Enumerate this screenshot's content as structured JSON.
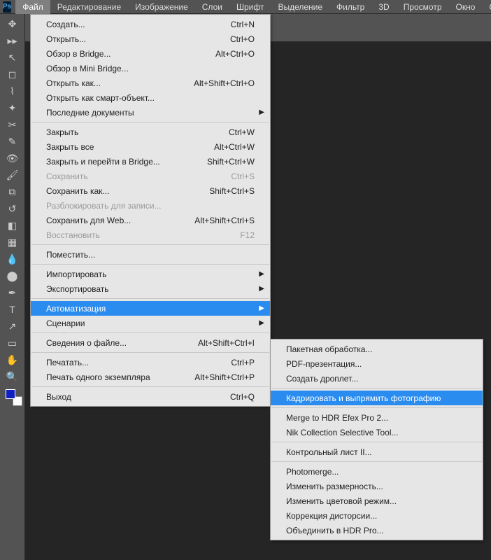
{
  "menubar": {
    "items": [
      "Файл",
      "Редактирование",
      "Изображение",
      "Слои",
      "Шрифт",
      "Выделение",
      "Фильтр",
      "3D",
      "Просмотр",
      "Окно",
      "Справка"
    ],
    "active_index": 0
  },
  "file_menu": [
    {
      "type": "item",
      "label": "Создать...",
      "shortcut": "Ctrl+N"
    },
    {
      "type": "item",
      "label": "Открыть...",
      "shortcut": "Ctrl+O"
    },
    {
      "type": "item",
      "label": "Обзор в Bridge...",
      "shortcut": "Alt+Ctrl+O"
    },
    {
      "type": "item",
      "label": "Обзор в Mini Bridge..."
    },
    {
      "type": "item",
      "label": "Открыть как...",
      "shortcut": "Alt+Shift+Ctrl+O"
    },
    {
      "type": "item",
      "label": "Открыть как смарт-объект..."
    },
    {
      "type": "item",
      "label": "Последние документы",
      "submenu": true
    },
    {
      "type": "sep"
    },
    {
      "type": "item",
      "label": "Закрыть",
      "shortcut": "Ctrl+W"
    },
    {
      "type": "item",
      "label": "Закрыть все",
      "shortcut": "Alt+Ctrl+W"
    },
    {
      "type": "item",
      "label": "Закрыть и перейти в Bridge...",
      "shortcut": "Shift+Ctrl+W"
    },
    {
      "type": "item",
      "label": "Сохранить",
      "shortcut": "Ctrl+S",
      "disabled": true
    },
    {
      "type": "item",
      "label": "Сохранить как...",
      "shortcut": "Shift+Ctrl+S"
    },
    {
      "type": "item",
      "label": "Разблокировать для записи...",
      "disabled": true
    },
    {
      "type": "item",
      "label": "Сохранить для Web...",
      "shortcut": "Alt+Shift+Ctrl+S"
    },
    {
      "type": "item",
      "label": "Восстановить",
      "shortcut": "F12",
      "disabled": true
    },
    {
      "type": "sep"
    },
    {
      "type": "item",
      "label": "Поместить..."
    },
    {
      "type": "sep"
    },
    {
      "type": "item",
      "label": "Импортировать",
      "submenu": true
    },
    {
      "type": "item",
      "label": "Экспортировать",
      "submenu": true
    },
    {
      "type": "sep"
    },
    {
      "type": "item",
      "label": "Автоматизация",
      "submenu": true,
      "highlighted": true
    },
    {
      "type": "item",
      "label": "Сценарии",
      "submenu": true
    },
    {
      "type": "sep"
    },
    {
      "type": "item",
      "label": "Сведения о файле...",
      "shortcut": "Alt+Shift+Ctrl+I"
    },
    {
      "type": "sep"
    },
    {
      "type": "item",
      "label": "Печатать...",
      "shortcut": "Ctrl+P"
    },
    {
      "type": "item",
      "label": "Печать одного экземпляра",
      "shortcut": "Alt+Shift+Ctrl+P"
    },
    {
      "type": "sep"
    },
    {
      "type": "item",
      "label": "Выход",
      "shortcut": "Ctrl+Q"
    }
  ],
  "automation_submenu": [
    {
      "type": "item",
      "label": "Пакетная обработка..."
    },
    {
      "type": "item",
      "label": "PDF-презентация..."
    },
    {
      "type": "item",
      "label": "Создать дроплет..."
    },
    {
      "type": "sep"
    },
    {
      "type": "item",
      "label": "Кадрировать и выпрямить фотографию",
      "highlighted": true
    },
    {
      "type": "sep"
    },
    {
      "type": "item",
      "label": "Merge to HDR Efex Pro 2..."
    },
    {
      "type": "item",
      "label": "Nik Collection Selective Tool..."
    },
    {
      "type": "sep"
    },
    {
      "type": "item",
      "label": "Контрольный лист II..."
    },
    {
      "type": "sep"
    },
    {
      "type": "item",
      "label": "Photomerge..."
    },
    {
      "type": "item",
      "label": "Изменить размерность..."
    },
    {
      "type": "item",
      "label": "Изменить цветовой режим..."
    },
    {
      "type": "item",
      "label": "Коррекция дисторсии..."
    },
    {
      "type": "item",
      "label": "Объединить в HDR Pro..."
    }
  ],
  "tools": [
    {
      "name": "move-tool",
      "glyph": "✥"
    },
    {
      "name": "expand-tool",
      "glyph": "▸▸"
    },
    {
      "name": "sep"
    },
    {
      "name": "arrow-tool",
      "glyph": "↖"
    },
    {
      "name": "marquee-tool",
      "glyph": "◻"
    },
    {
      "name": "lasso-tool",
      "glyph": "⌇"
    },
    {
      "name": "wand-tool",
      "glyph": "✦"
    },
    {
      "name": "crop-tool",
      "glyph": "✂"
    },
    {
      "name": "eyedropper-tool",
      "glyph": "✎"
    },
    {
      "name": "eye-tool",
      "glyph": "👁"
    },
    {
      "name": "brush-tool",
      "glyph": "🖌"
    },
    {
      "name": "stamp-tool",
      "glyph": "⧉"
    },
    {
      "name": "history-tool",
      "glyph": "↺"
    },
    {
      "name": "eraser-tool",
      "glyph": "◧"
    },
    {
      "name": "gradient-tool",
      "glyph": "▦"
    },
    {
      "name": "blur-tool",
      "glyph": "💧"
    },
    {
      "name": "dodge-tool",
      "glyph": "⬤"
    },
    {
      "name": "pen-tool",
      "glyph": "✒"
    },
    {
      "name": "type-tool",
      "glyph": "T"
    },
    {
      "name": "path-tool",
      "glyph": "↗"
    },
    {
      "name": "shape-tool",
      "glyph": "▭"
    },
    {
      "name": "hand-tool",
      "glyph": "✋"
    },
    {
      "name": "zoom-tool",
      "glyph": "🔍"
    }
  ]
}
